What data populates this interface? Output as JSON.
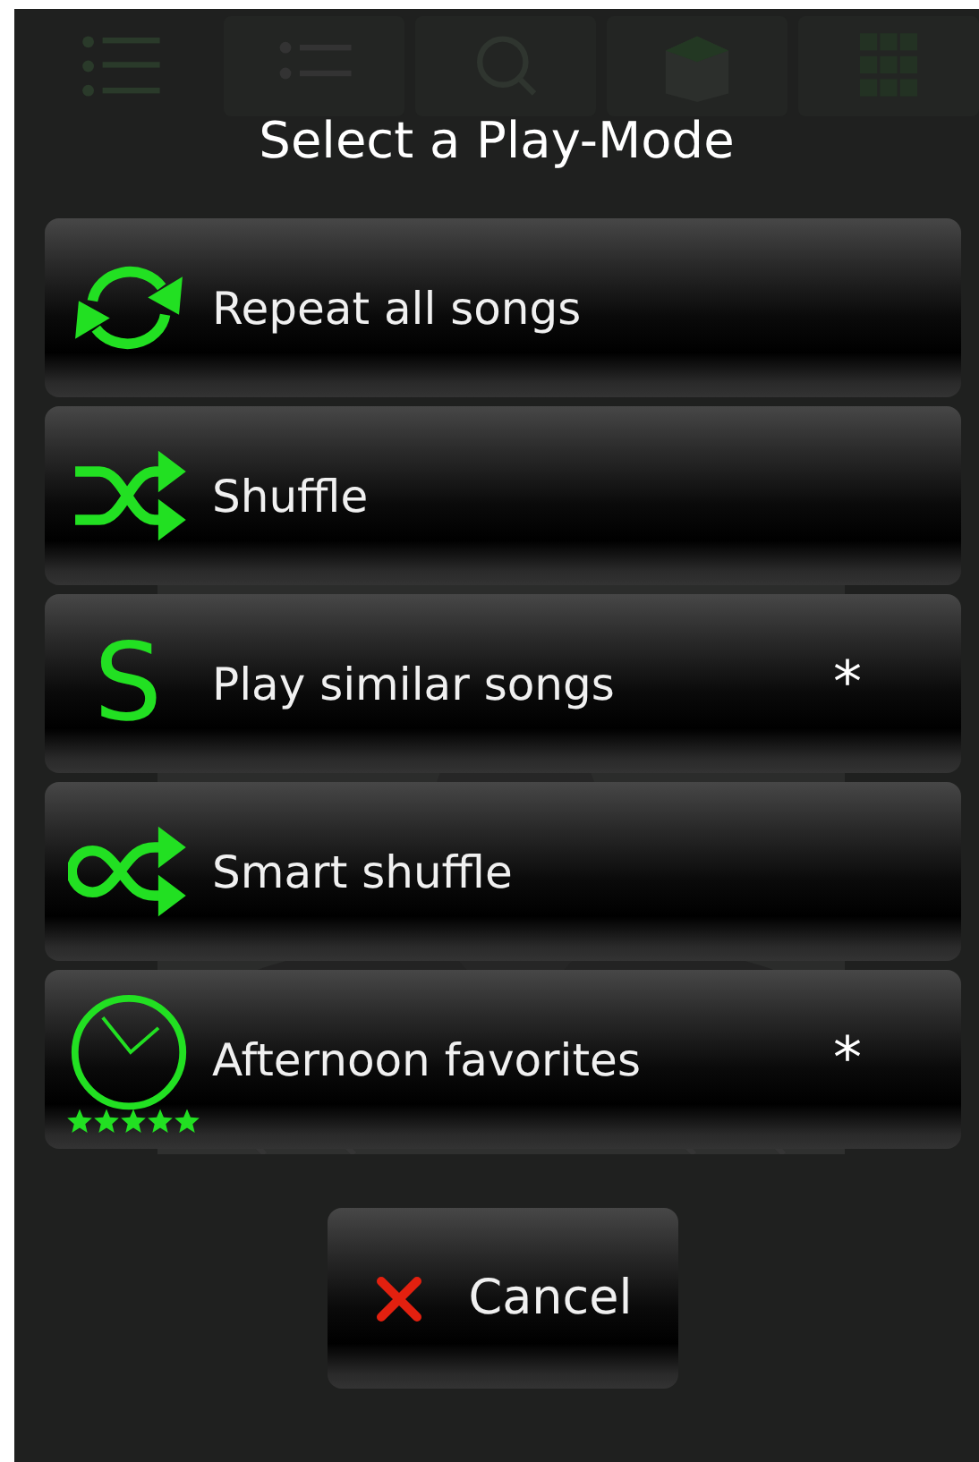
{
  "dialog": {
    "title": "Select a Play-Mode",
    "items": [
      {
        "kind": "repeat",
        "label": "Repeat all songs"
      },
      {
        "kind": "shuffle",
        "label": "Shuffle"
      },
      {
        "kind": "similar",
        "glyph": "S",
        "label": "Play similar songs",
        "marker": "*"
      },
      {
        "kind": "smart",
        "label": "Smart shuffle"
      },
      {
        "kind": "clock",
        "label": "Afternoon favorites",
        "stars": 5,
        "marker": "*"
      }
    ],
    "cancel": {
      "label": "Cancel"
    }
  }
}
